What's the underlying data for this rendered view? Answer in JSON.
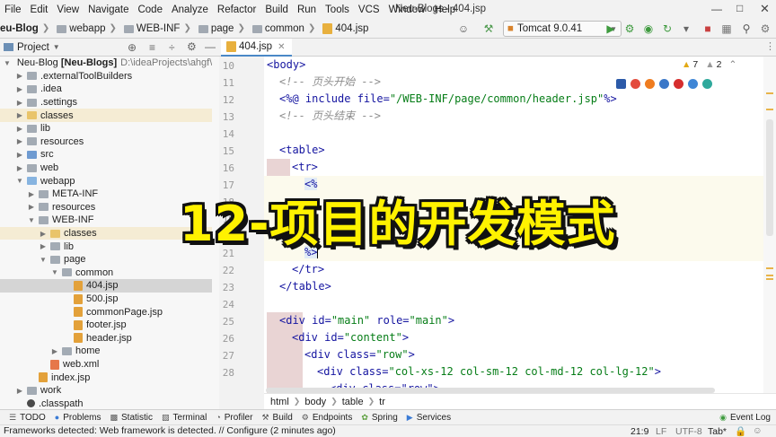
{
  "menu": [
    "File",
    "Edit",
    "View",
    "Navigate",
    "Code",
    "Analyze",
    "Refactor",
    "Build",
    "Run",
    "Tools",
    "VCS",
    "Window",
    "Help"
  ],
  "window_title": "Neu-Blogs - 404.jsp",
  "breadcrumb": [
    "eu-Blog",
    "webapp",
    "WEB-INF",
    "page",
    "common",
    "404.jsp"
  ],
  "run_config": "Tomcat 9.0.41",
  "project_panel": {
    "title": "Project"
  },
  "tree": [
    {
      "label": "Neu-Blog",
      "bold": "[Neu-Blogs]",
      "path": "D:\\ideaProjects\\ahgf\\Ne"
    },
    {
      "label": ".externalToolBuilders"
    },
    {
      "label": ".idea"
    },
    {
      "label": ".settings"
    },
    {
      "label": "classes"
    },
    {
      "label": "lib"
    },
    {
      "label": "resources"
    },
    {
      "label": "src"
    },
    {
      "label": "web"
    },
    {
      "label": "webapp"
    },
    {
      "label": "META-INF"
    },
    {
      "label": "resources"
    },
    {
      "label": "WEB-INF"
    },
    {
      "label": "classes"
    },
    {
      "label": "lib"
    },
    {
      "label": "page"
    },
    {
      "label": "common"
    },
    {
      "label": "404.jsp"
    },
    {
      "label": "500.jsp"
    },
    {
      "label": "commonPage.jsp"
    },
    {
      "label": "footer.jsp"
    },
    {
      "label": "header.jsp"
    },
    {
      "label": "home"
    },
    {
      "label": "web.xml"
    },
    {
      "label": "index.jsp"
    },
    {
      "label": "work"
    },
    {
      "label": ".classpath"
    }
  ],
  "editor_tab": "404.jsp",
  "line_numbers": [
    "10",
    "11",
    "12",
    "13",
    "14",
    "15",
    "16",
    "17",
    "18",
    "19",
    "20",
    "21",
    "22",
    "23",
    "24",
    "25",
    "26",
    "27",
    "28"
  ],
  "code": {
    "l10": "<body>",
    "l11": "<!-- 页头开始 -->",
    "l12a": "<%@ include ",
    "l12b": "file=",
    "l12c": "\"/WEB-INF/page/common/header.jsp\"",
    "l12d": "%>",
    "l13": "<!-- 页头结束 -->",
    "l15": "<table>",
    "l16": "<tr>",
    "l17": "<%",
    "l21": "%>",
    "l22": "</tr>",
    "l23": "</table>",
    "l25a": "<div ",
    "l25b": "id=",
    "l25c": "\"main\"",
    "l25d": " role=",
    "l25e": "\"main\"",
    "l25f": ">",
    "l26a": "<div ",
    "l26b": "id=",
    "l26c": "\"content\"",
    "l26d": ">",
    "l27a": "<div ",
    "l27b": "class=",
    "l27c": "\"row\"",
    "l27d": ">",
    "l28a": "<div ",
    "l28b": "class=",
    "l28c": "\"col-xs-12 col-sm-12 col-md-12 col-lg-12\"",
    "l28d": ">",
    "l29": "<div class=\"row\">"
  },
  "inspections": {
    "warnings": "7",
    "weak": "2"
  },
  "editor_breadcrumb": [
    "html",
    "body",
    "table",
    "tr"
  ],
  "overlay_text": "12-项目的开发模式",
  "tool_windows": [
    "TODO",
    "Problems",
    "Statistic",
    "Terminal",
    "Profiler",
    "Build",
    "Endpoints",
    "Spring",
    "Services"
  ],
  "event_log": "Event Log",
  "status": {
    "message": "Frameworks detected: Web framework is detected. // Configure (2 minutes ago)",
    "position": "21:9",
    "line_sep": "LF",
    "encoding": "UTF-8",
    "indent": "Tab*"
  }
}
